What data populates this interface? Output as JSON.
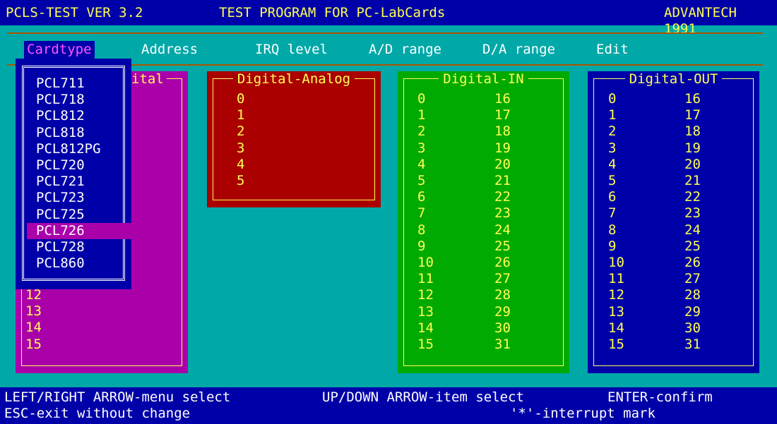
{
  "title": {
    "left": "PCLS-TEST VER 3.2",
    "center": "TEST PROGRAM FOR PC-LabCards",
    "right": "ADVANTECH 1991"
  },
  "menu": [
    {
      "label": "Cardtype"
    },
    {
      "label": "Address"
    },
    {
      "label": "IRQ level"
    },
    {
      "label": "A/D range"
    },
    {
      "label": "D/A range"
    },
    {
      "label": "Edit"
    }
  ],
  "dropdown": {
    "items": [
      "PCL711",
      "PCL718",
      "PCL812",
      "PCL818",
      "PCL812PG",
      "PCL720",
      "PCL721",
      "PCL723",
      "PCL725",
      "PCL726",
      "PCL728",
      "PCL860"
    ],
    "selected": "PCL726"
  },
  "panels": {
    "digital": {
      "title_fragment": "ital",
      "visible_numbers": [
        "12",
        "13",
        "14",
        "15"
      ]
    },
    "da": {
      "title": "Digital-Analog",
      "numbers": [
        "0",
        "1",
        "2",
        "3",
        "4",
        "5"
      ]
    },
    "din": {
      "title": "Digital-IN",
      "col1": [
        "0",
        "1",
        "2",
        "3",
        "4",
        "5",
        "6",
        "7",
        "8",
        "9",
        "10",
        "11",
        "12",
        "13",
        "14",
        "15"
      ],
      "col2": [
        "16",
        "17",
        "18",
        "19",
        "20",
        "21",
        "22",
        "23",
        "24",
        "25",
        "26",
        "27",
        "28",
        "29",
        "30",
        "31"
      ]
    },
    "dout": {
      "title": "Digital-OUT",
      "col1": [
        "0",
        "1",
        "2",
        "3",
        "4",
        "5",
        "6",
        "7",
        "8",
        "9",
        "10",
        "11",
        "12",
        "13",
        "14",
        "15"
      ],
      "col2": [
        "16",
        "17",
        "18",
        "19",
        "20",
        "21",
        "22",
        "23",
        "24",
        "25",
        "26",
        "27",
        "28",
        "29",
        "30",
        "31"
      ]
    }
  },
  "status": {
    "line1_left": "LEFT/RIGHT ARROW-menu select",
    "line1_center": "UP/DOWN ARROW-item select",
    "line1_right": "ENTER-confirm",
    "line2_left": "ESC-exit without change",
    "line2_right": "'*'-interrupt mark"
  },
  "colors": {
    "background": "#00A8A8",
    "bar": "#0000A8",
    "text": "#FFFF55",
    "menu_text": "#FFFFFF",
    "selected": "#FF55FF",
    "digital_panel": "#AA00AA",
    "da_panel": "#AA0000",
    "din_panel": "#00AA00",
    "dout_panel": "#0000A8"
  }
}
